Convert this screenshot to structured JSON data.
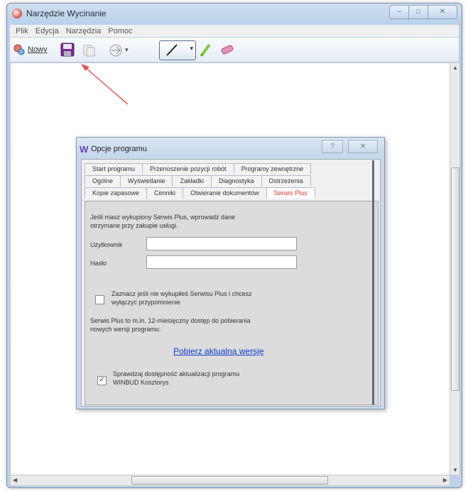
{
  "window": {
    "title": "Narzędzie Wycinanie"
  },
  "menu": [
    "Plik",
    "Edycja",
    "Narzędzia",
    "Pomoc"
  ],
  "toolbar": {
    "new_label": "Nowy"
  },
  "dialog": {
    "title": "Opcje programu",
    "tabs_row1": [
      "Start programu",
      "Przenoszenie pozycji robót",
      "Programy zewnętrzne"
    ],
    "tabs_row2": [
      "Ogólne",
      "Wyświetlanie",
      "Zakładki",
      "Diagnostyka",
      "Ostrzeżenia"
    ],
    "tabs_row3": [
      "Kopie zapasowe",
      "Cenniki",
      "Otwieranie dokumentów",
      "Serwis Plus"
    ],
    "intro_line1": "Jeśli masz wykupiony Serwis Plus, wprowadź dane",
    "intro_line2": "otrzymane przy zakupie usługi.",
    "user_label": "Użytkownik",
    "password_label": "Hasło",
    "remind_line1": "Zaznacz jeśli nie wykupiłeś Serwisu Plus i chcesz",
    "remind_line2": "wyłączyć przypomnienie",
    "info_line1": "Serwis Plus to m.in. 12-miesięczny dostęp do pobierania",
    "info_line2": "nowych wersji programu.",
    "download_link": "Pobierz aktualną wersję",
    "check_update_line1": "Sprawdzaj dostępność aktualizacji programu",
    "check_update_line2": "WINBUD Kosztorys"
  }
}
